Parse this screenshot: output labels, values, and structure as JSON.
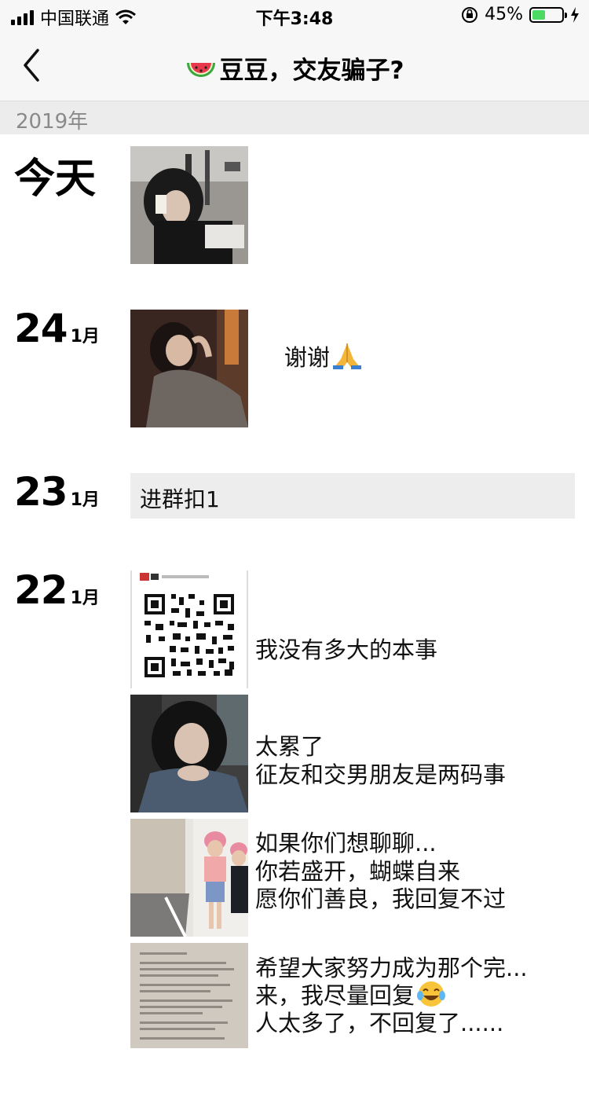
{
  "status_bar": {
    "carrier": "中国联通",
    "time": "下午3:48",
    "battery": "45%",
    "battery_level": 0.45
  },
  "nav": {
    "title": "豆豆，交友骗子?",
    "back_icon": "chevron-left-icon",
    "title_emoji": "watermelon-icon"
  },
  "year": "2019年",
  "days": [
    {
      "label": "今天",
      "is_today": true,
      "posts": [
        {
          "type": "photo",
          "caption": ""
        }
      ]
    },
    {
      "day": "24",
      "month": "1月",
      "posts": [
        {
          "type": "photo",
          "caption": "谢谢",
          "emoji": "pray-icon"
        }
      ]
    },
    {
      "day": "23",
      "month": "1月",
      "posts": [
        {
          "type": "text",
          "caption": "进群扣1"
        }
      ]
    },
    {
      "day": "22",
      "month": "1月",
      "posts": [
        {
          "type": "qr-photo",
          "lines": [
            "我没有多大的本事",
            "太累了",
            "如果你们想聊聊..."
          ]
        },
        {
          "type": "photo",
          "lines": [
            "征友和交男朋友是两码事",
            "你若盛开，蝴蝶自来",
            "希望大家努力成为那个完..."
          ]
        },
        {
          "type": "photo",
          "lines": [
            "愿你们善良，我回复不过",
            "来，我尽量回复"
          ],
          "emoji": "laughing-tears-icon"
        },
        {
          "type": "photo",
          "lines": [
            "人太多了，不回复了......"
          ]
        }
      ]
    }
  ]
}
